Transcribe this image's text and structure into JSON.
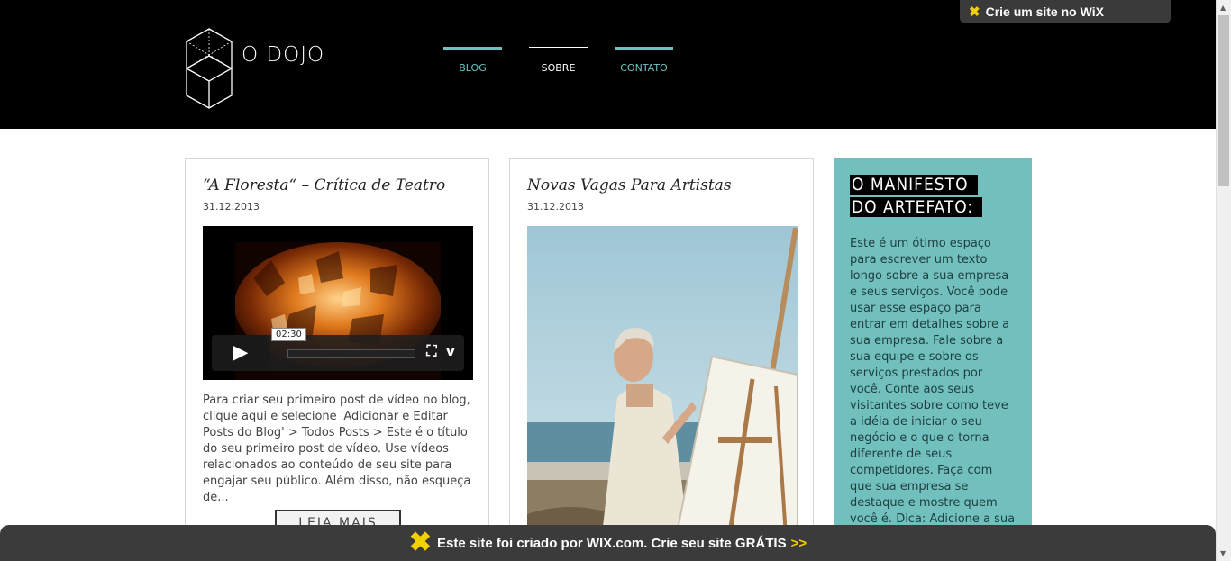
{
  "site": {
    "name": "O DOJO"
  },
  "nav": {
    "items": [
      {
        "label": "BLOG"
      },
      {
        "label": "SOBRE"
      },
      {
        "label": "CONTATO"
      }
    ]
  },
  "wix_badge": {
    "label": "Crie um site no WiX"
  },
  "posts": [
    {
      "title": "“A Floresta“ – Crítica de Teatro",
      "date": "31.12.2013",
      "video_time": "02:30",
      "excerpt": "Para criar seu primeiro post de vídeo no blog, clique aqui e selecione 'Adicionar e Editar Posts do Blog' > Todos Posts > Este é o título do seu primeiro post de vídeo. Use vídeos relacionados ao conteúdo de seu site para engajar seu público. Além disso, não esqueça de...",
      "read_more": "LEIA MAIS"
    },
    {
      "title": "Novas Vagas Para Artistas",
      "date": "31.12.2013"
    }
  ],
  "manifest": {
    "title": "O MANIFESTO DO ARTEFATO:",
    "text": "Este é um ótimo espaço para escrever um texto longo sobre a sua empresa e seus serviços. Você pode usar esse espaço para entrar em detalhes sobre a sua empresa. Fale sobre a sua equipe e sobre os serviços prestados por você. Conte aos seus visitantes sobre como teve a idéia de iniciar o seu negócio e o que o torna diferente de seus competidores. Faça com que sua empresa se destaque e mostre quem você é. Dica: Adicione a sua própria imagem clicando duas vezes"
  },
  "footer_banner": {
    "text": "Este site foi criado por WIX.com. Crie seu site GRÁTIS",
    "arrow": ">>"
  },
  "colors": {
    "accent": "#6ec1c0",
    "manifest_bg": "#72c0bd",
    "header_bg": "#000000",
    "wix_yellow": "#f3d100"
  }
}
